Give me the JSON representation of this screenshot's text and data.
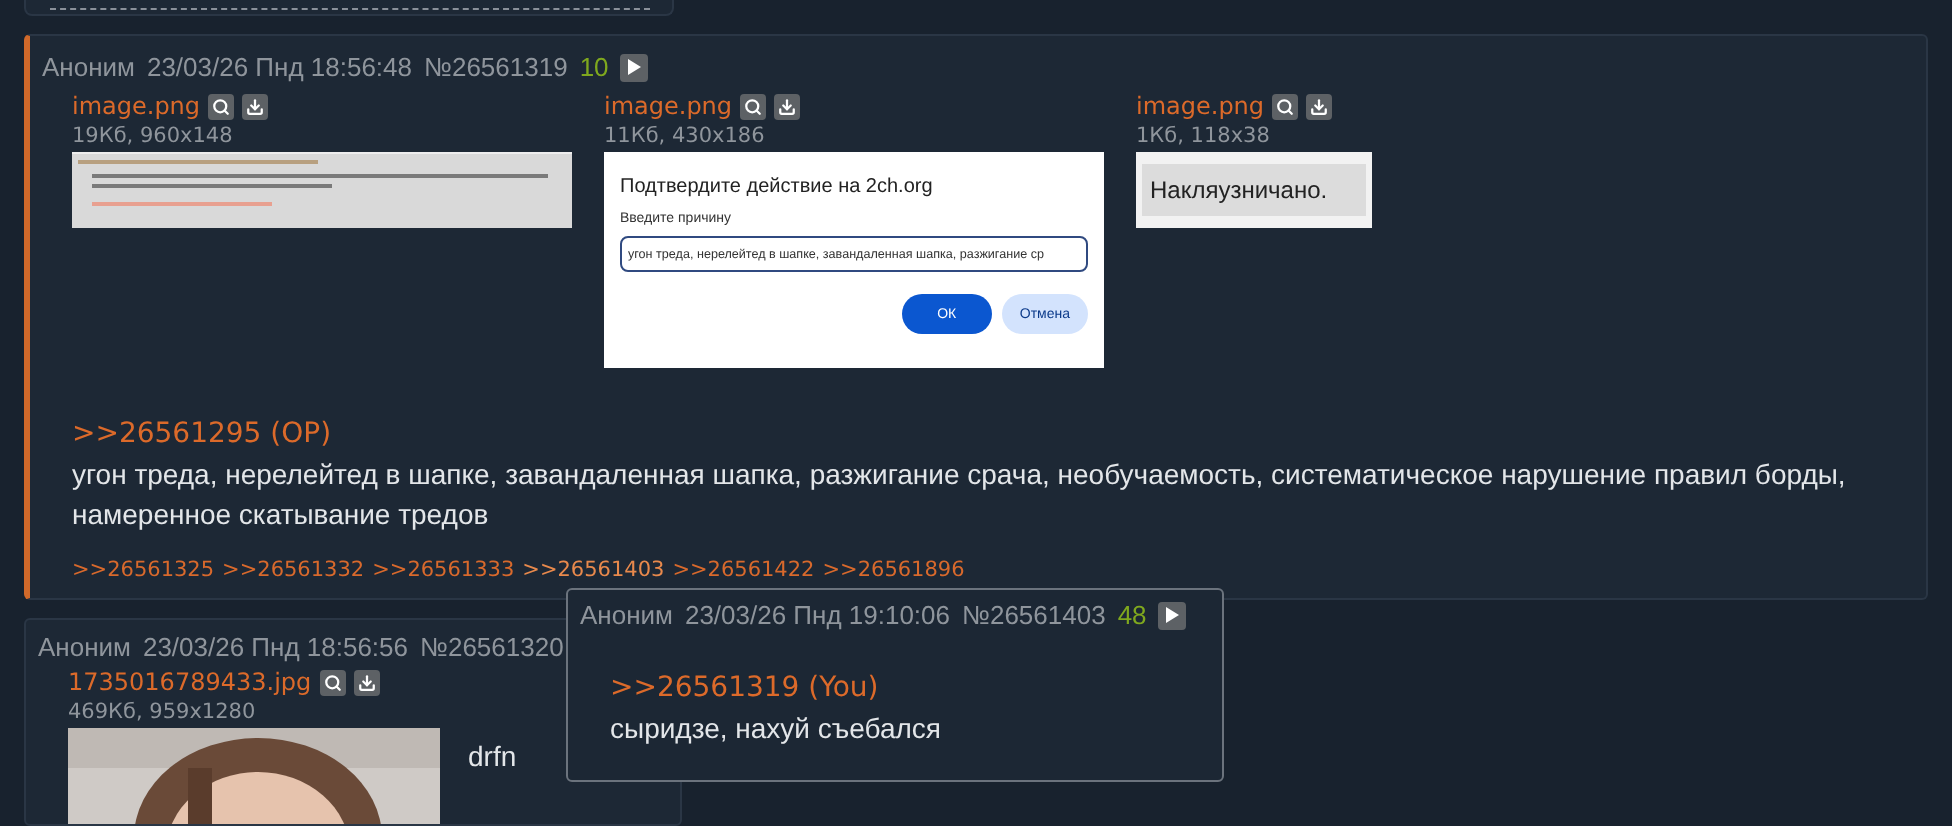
{
  "thread": [
    {
      "author": "Аноним",
      "date": "23/03/26 Пнд 18:56:48",
      "number": "№26561319",
      "count": "10",
      "files": [
        {
          "name": "image.png",
          "info": "19Кб, 960x148",
          "kind": "screenshot"
        },
        {
          "name": "image.png",
          "info": "11Кб, 430x186",
          "kind": "dialog",
          "dialog": {
            "title": "Подтвердите действие на 2ch.org",
            "label": "Введите причину",
            "value": "угон треда, нерелейтед в шапке, завандаленная шапка, разжигание ср",
            "buttons": [
              "ОК",
              "Отмена"
            ]
          }
        },
        {
          "name": "image.png",
          "info": "1Кб, 118x38",
          "kind": "label",
          "text": "Накляузничано."
        }
      ],
      "reply_to": ">>26561295 (OP)",
      "text": "угон треда, нерелейтед в шапке, завандаленная шапка, разжигание срача, необучаемость, систематическое нарушение правил борды, намеренное скатывание тредов",
      "replies": [
        {
          "text": ">>26561325",
          "hovered": false
        },
        {
          "text": ">>26561332",
          "hovered": false
        },
        {
          "text": ">>26561333",
          "hovered": false
        },
        {
          "text": ">>26561403",
          "hovered": true
        },
        {
          "text": ">>26561422",
          "hovered": false
        },
        {
          "text": ">>26561896",
          "hovered": false
        }
      ]
    },
    {
      "author": "Аноним",
      "date": "23/03/26 Пнд 18:56:56",
      "number": "№26561320",
      "files": [
        {
          "name": "1735016789433.jpg",
          "info": "469Кб, 959x1280",
          "kind": "picture"
        }
      ],
      "text": "drfn"
    }
  ],
  "popup": {
    "author": "Аноним",
    "date": "23/03/26 Пнд 19:10:06",
    "number": "№26561403",
    "count": "48",
    "reply_to": ">>26561319 (You)",
    "text": "сыридзе, нахуй съебался"
  }
}
